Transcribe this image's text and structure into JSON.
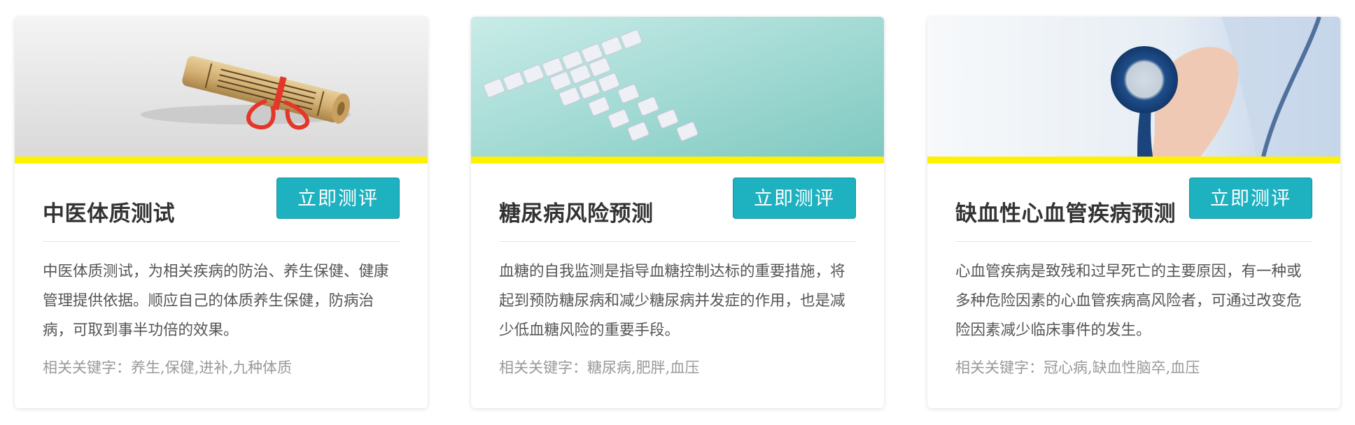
{
  "cards": [
    {
      "image_subject": "chinese-scroll-with-red-ribbon",
      "title": "中医体质测试",
      "button": "立即测评",
      "description": "中医体质测试，为相关疾病的防治、养生保健、健康管理提供依据。顺应自己的体质养生保健，防病治病，可取到事半功倍的效果。",
      "keywords": "相关关键字：养生,保健,进补,九种体质"
    },
    {
      "image_subject": "sugar-cubes-cross-on-teal",
      "title": "糖尿病风险预测",
      "button": "立即测评",
      "description": "血糖的自我监测是指导血糖控制达标的重要措施，将起到预防糖尿病和减少糖尿病并发症的作用，也是减少低血糖风险的重要手段。",
      "keywords": "相关关键字：糖尿病,肥胖,血压"
    },
    {
      "image_subject": "doctor-holding-stethoscope",
      "title": "缺血性心血管疾病预测",
      "button": "立即测评",
      "description": "心血管疾病是致残和过早死亡的主要原因，有一种或多种危险因素的心血管疾病高风险者，可通过改变危险因素减少临床事件的发生。",
      "keywords": "相关关键字：冠心病,缺血性脑卒,血压"
    }
  ],
  "colors": {
    "accent_bar": "#fff200",
    "button_bg": "#1eb1c0",
    "title": "#333333",
    "text": "#555555",
    "keywords": "#999999"
  }
}
